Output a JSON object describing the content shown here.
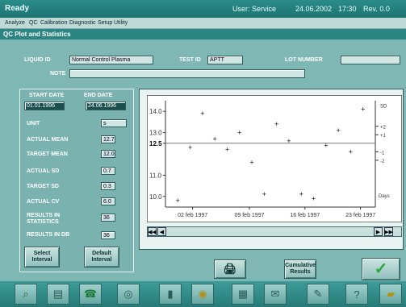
{
  "titlebar": {
    "status": "Ready",
    "user": "User: Service",
    "date": "24.06.2002",
    "time": "17:30",
    "rev": "Rev. 0.0"
  },
  "menu": [
    "Analyze",
    "QC",
    "Calibration",
    "Diagnostic",
    "Setup",
    "Utility"
  ],
  "panel_title": "QC Plot and Statistics",
  "header": {
    "liquid_id_label": "LIQUID ID",
    "liquid_id_value": "Normal Control Plasma",
    "test_id_label": "TEST ID",
    "test_id_value": "APTT",
    "lot_number_label": "LOT NUMBER",
    "lot_number_value": "",
    "note_label": "NOTE",
    "note_value": ""
  },
  "stats": {
    "start_date_label": "START DATE",
    "start_date_value": "01.01.1996",
    "end_date_label": "END DATE",
    "end_date_value": "24.06.1996",
    "unit_label": "UNIT",
    "unit_value": "s",
    "actual_mean_label": "ACTUAL MEAN",
    "actual_mean_value": "12.7",
    "target_mean_label": "TARGET MEAN",
    "target_mean_value": "12.0",
    "actual_sd_label": "ACTUAL SD",
    "actual_sd_value": "0.7",
    "target_sd_label": "TARGET SD",
    "target_sd_value": "0.3",
    "actual_cv_label": "ACTUAL CV",
    "actual_cv_value": "6.0",
    "results_stats_label": "RESULTS IN STATISTICS",
    "results_stats_value": "36",
    "results_db_label": "RESULTS IN DB",
    "results_db_value": "36"
  },
  "buttons": {
    "select_interval": "Select Interval",
    "default_interval": "Default Interval",
    "cumulative_results": "Cumulative Results"
  },
  "chart_data": {
    "type": "scatter",
    "y_ticks": [
      "14.0",
      "13.0",
      "12.5",
      "11.0",
      "10.0"
    ],
    "x_ticks": [
      "02 feb 1997",
      "09 feb 1997",
      "16 feb 1997",
      "23 feb 1997"
    ],
    "right_labels": [
      "SD",
      "+2",
      "+1",
      "-1",
      "-2"
    ],
    "right_bottom_label": "Days",
    "ylim": [
      9.5,
      14.5
    ],
    "mean": 12.5,
    "points": [
      {
        "x": 1,
        "y": 9.8
      },
      {
        "x": 2,
        "y": 12.3
      },
      {
        "x": 3,
        "y": 13.9
      },
      {
        "x": 4,
        "y": 12.7
      },
      {
        "x": 5,
        "y": 12.2
      },
      {
        "x": 6,
        "y": 13.0
      },
      {
        "x": 7,
        "y": 11.6
      },
      {
        "x": 8,
        "y": 10.1
      },
      {
        "x": 9,
        "y": 13.4
      },
      {
        "x": 10,
        "y": 12.6
      },
      {
        "x": 11,
        "y": 10.1
      },
      {
        "x": 12,
        "y": 9.9
      },
      {
        "x": 13,
        "y": 12.4
      },
      {
        "x": 14,
        "y": 13.1
      },
      {
        "x": 15,
        "y": 12.1
      },
      {
        "x": 16,
        "y": 14.1
      }
    ],
    "xlim": [
      0,
      17
    ]
  },
  "colors": {
    "accent": "#2a8583",
    "ok_green": "#27a844"
  },
  "icons": [
    "search-icon",
    "document-icon",
    "phone-icon",
    "disc-icon",
    "trash-icon",
    "eye-icon",
    "chart-icon",
    "mail-icon",
    "pen-icon",
    "question-icon",
    "folder-icon"
  ]
}
